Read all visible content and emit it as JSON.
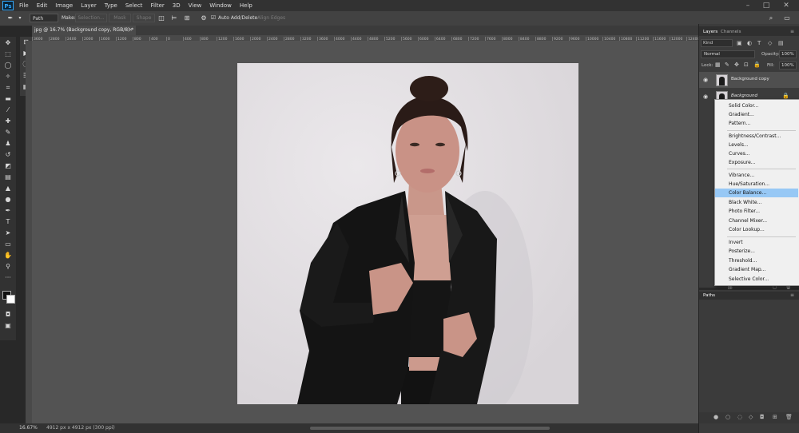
{
  "app": {
    "logo": "Ps",
    "menu": [
      "File",
      "Edit",
      "Image",
      "Layer",
      "Type",
      "Select",
      "Filter",
      "3D",
      "View",
      "Window",
      "Help"
    ]
  },
  "options": {
    "mode": "Path",
    "make_label": "Make:",
    "selection": "Selection...",
    "mask": "Mask",
    "shape": "Shape",
    "auto_add_delete": "Auto Add/Delete",
    "align_edges": "Align Edges"
  },
  "document": {
    "tab_title": "jpg @ 16.7% (Background copy, RGB/8) *",
    "zoom": "16.67%",
    "info": "4912 px x 4912 px (300 ppi)"
  },
  "ruler": {
    "h_ticks": [
      "3600",
      "2800",
      "2400",
      "2000",
      "1600",
      "1200",
      "800",
      "400",
      "0",
      "400",
      "800",
      "1200",
      "1600",
      "2000",
      "2400",
      "2800",
      "3200",
      "3600",
      "4000",
      "4400",
      "4800",
      "5200",
      "5600",
      "6000",
      "6400",
      "6800",
      "7200",
      "7600",
      "8000",
      "8400",
      "8800",
      "9200",
      "9600",
      "10000",
      "10400",
      "10800",
      "11200",
      "11600",
      "12000",
      "12400",
      "12800",
      "13200",
      "13600",
      "14000",
      "14400"
    ]
  },
  "panels": {
    "tabs": [
      "Layers",
      "Channels"
    ],
    "kind_label": "Kind",
    "blend_mode": "Normal",
    "opacity_label": "Opacity:",
    "opacity": "100%",
    "lock_label": "Lock:",
    "fill_label": "Fill:",
    "fill": "100%",
    "layers": [
      {
        "name": "Background copy",
        "visible": true,
        "selected": true
      },
      {
        "name": "Background",
        "visible": true,
        "locked": true
      }
    ],
    "paths_tab": "Paths"
  },
  "adjustment_menu": {
    "groups": [
      [
        "Solid Color...",
        "Gradient...",
        "Pattern..."
      ],
      [
        "Brightness/Contrast...",
        "Levels...",
        "Curves...",
        "Exposure..."
      ],
      [
        "Vibrance...",
        "Hue/Saturation...",
        "Color Balance...",
        "Black  White...",
        "Photo Filter...",
        "Channel Mixer...",
        "Color Lookup..."
      ],
      [
        "Invert",
        "Posterize...",
        "Threshold...",
        "Gradient Map...",
        "Selective Color..."
      ]
    ],
    "highlighted": "Color Balance...",
    "highlight_color": "#97c8f5"
  },
  "colors": {
    "ps_blue": "#31a8ff",
    "canvas_bg": "#535353",
    "panel_bg": "#3b3b3b"
  }
}
